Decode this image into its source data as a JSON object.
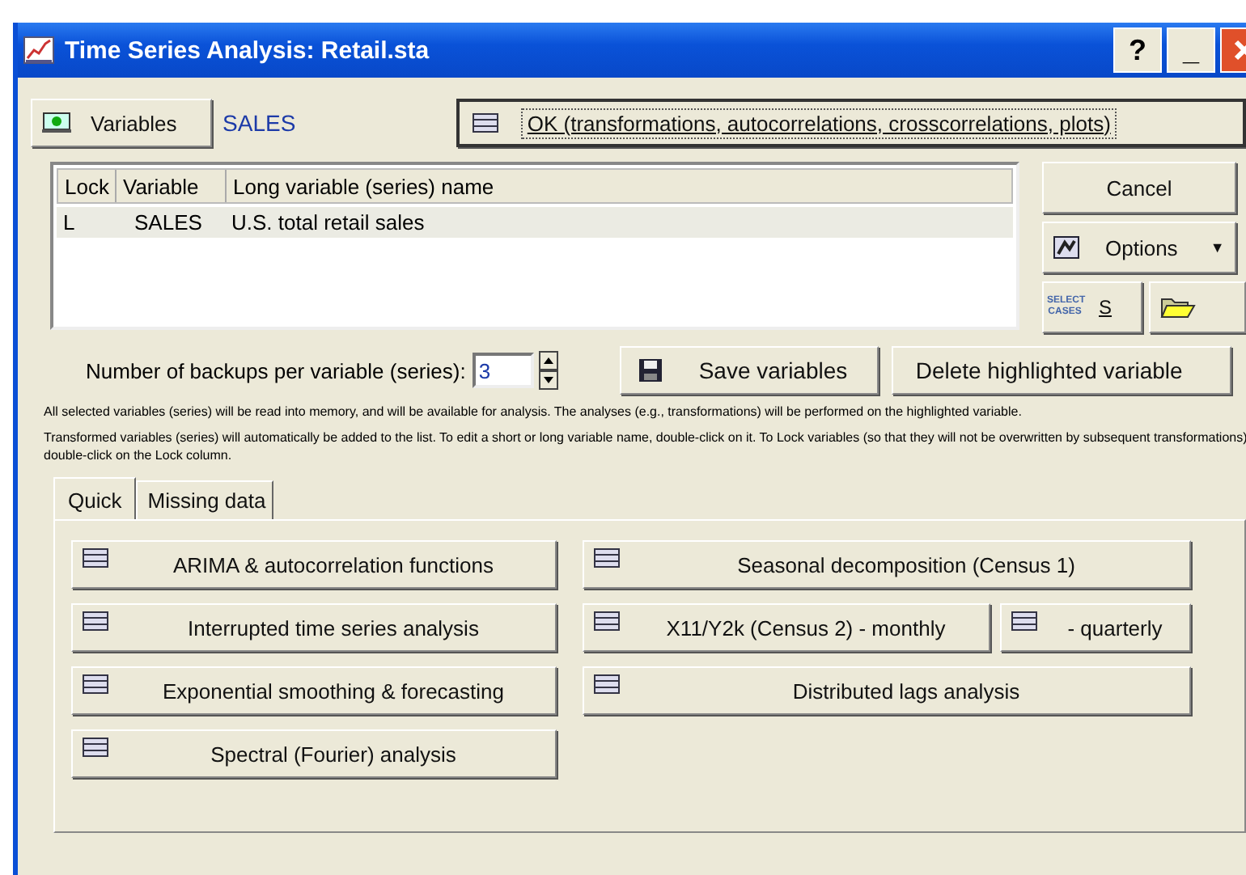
{
  "window": {
    "title": "Time Series Analysis: Retail.sta",
    "title_buttons": [
      "?",
      "_"
    ]
  },
  "variables_button": {
    "label": "Variables"
  },
  "selected_variable": "SALES",
  "ok_button": {
    "label": "OK (transformations, autocorrelations, crosscorrelations, plots)"
  },
  "table": {
    "columns": [
      "Lock",
      "Variable",
      "Long variable (series) name"
    ],
    "rows": [
      {
        "lock": "L",
        "variable": "SALES",
        "name": "U.S. total retail sales",
        "selected": true
      }
    ]
  },
  "cancel_button": {
    "label": "Cancel"
  },
  "options_button": {
    "label": "Options",
    "caret": "▼"
  },
  "select_cases_button": {
    "icon_text": "SELECT CASES",
    "label": "S"
  },
  "backups": {
    "label": "Number of backups per variable (series):",
    "value": "3"
  },
  "save_button": {
    "label": "Save variables"
  },
  "delete_button": {
    "label": "Delete highlighted variable"
  },
  "notes": [
    "All selected variables (series) will be read into memory, and will be available for analysis. The analyses (e.g., transformations) will be performed on the highlighted variable.",
    "Transformed variables (series) will automatically be added to the list. To edit a short or long variable name, double-click on it. To Lock variables (so that they will not be overwritten by subsequent transformations) double-click on the Lock column."
  ],
  "tabs": [
    {
      "label": "Quick",
      "selected": true
    },
    {
      "label": "Missing data",
      "selected": false
    }
  ],
  "quick_rows": [
    [
      {
        "label": "ARIMA & autocorrelation functions",
        "kind": "wide"
      },
      {
        "label": "Seasonal decomposition (Census 1)",
        "kind": "wide"
      }
    ],
    [
      {
        "label": "Interrupted time series analysis",
        "kind": "wide"
      },
      {
        "label": "X11/Y2k (Census 2) - monthly",
        "kind": "split"
      },
      {
        "label": "- quarterly",
        "kind": "small"
      }
    ],
    [
      {
        "label": "Exponential smoothing & forecasting",
        "kind": "wide"
      },
      {
        "label": "Distributed lags analysis",
        "kind": "wide"
      }
    ],
    [
      {
        "label": "Spectral (Fourier) analysis",
        "kind": "wide"
      }
    ]
  ]
}
